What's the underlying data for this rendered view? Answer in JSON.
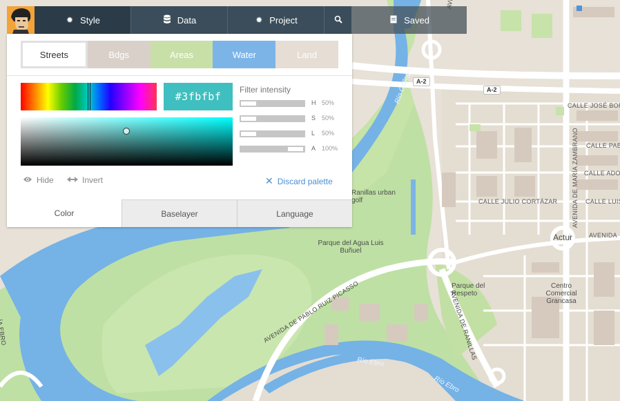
{
  "nav": {
    "style_label": "Style",
    "data_label": "Data",
    "project_label": "Project",
    "saved_label": "Saved"
  },
  "layer_tabs": {
    "streets": "Streets",
    "bdgs": "Bdgs",
    "areas": "Areas",
    "water": "Water",
    "land": "Land"
  },
  "color_picker": {
    "hex_value": "#3fbfbf",
    "filter_title": "Filter intensity",
    "sliders": [
      {
        "letter": "H",
        "value": "50%",
        "level": 0.5
      },
      {
        "letter": "S",
        "value": "50%",
        "level": 0.5
      },
      {
        "letter": "L",
        "value": "50%",
        "level": 0.5
      },
      {
        "letter": "A",
        "value": "100%",
        "level": 1.0
      }
    ]
  },
  "actions": {
    "hide_label": "Hide",
    "invert_label": "Invert",
    "discard_label": "Discard palette"
  },
  "bottom_tabs": {
    "color": "Color",
    "baselayer": "Baselayer",
    "language": "Language"
  },
  "map_labels": {
    "a2_shield_1": "A-2",
    "a2_shield_2": "A-2",
    "avenida_top": "AVENIDA",
    "calle_jose_boro": "CALLE JOSÉ BORO",
    "calle_pablo": "CALLE PABLO",
    "calle_adol": "CALLE ADOL",
    "calle_julio": "CALLE JULIO CORTÁZAR",
    "calle_luis": "CALLE LUIS",
    "avenida_zambrano": "AVENIDA DE MARÍA ZAMBRANO",
    "actur": "Actur",
    "avenida_right": "AVENIDA",
    "rio_gallego": "Río Gállego",
    "ranillas_golf": "Ranillas urban golf",
    "parque_agua": "Parque del Agua Luis Buñuel",
    "parque_respeto": "Parque del Respeto",
    "centro_comercial": "Centro Comercial Grancasa",
    "avenida_picasso": "AVENIDA DE PABLO RUIZ PICASSO",
    "avenida_ranillas": "AVENIDA DE RANILLAS",
    "rio_ebro_1": "Río Ebro",
    "rio_ebro_2": "Río Ebro",
    "ebro_left": "ÍA EBRO"
  }
}
